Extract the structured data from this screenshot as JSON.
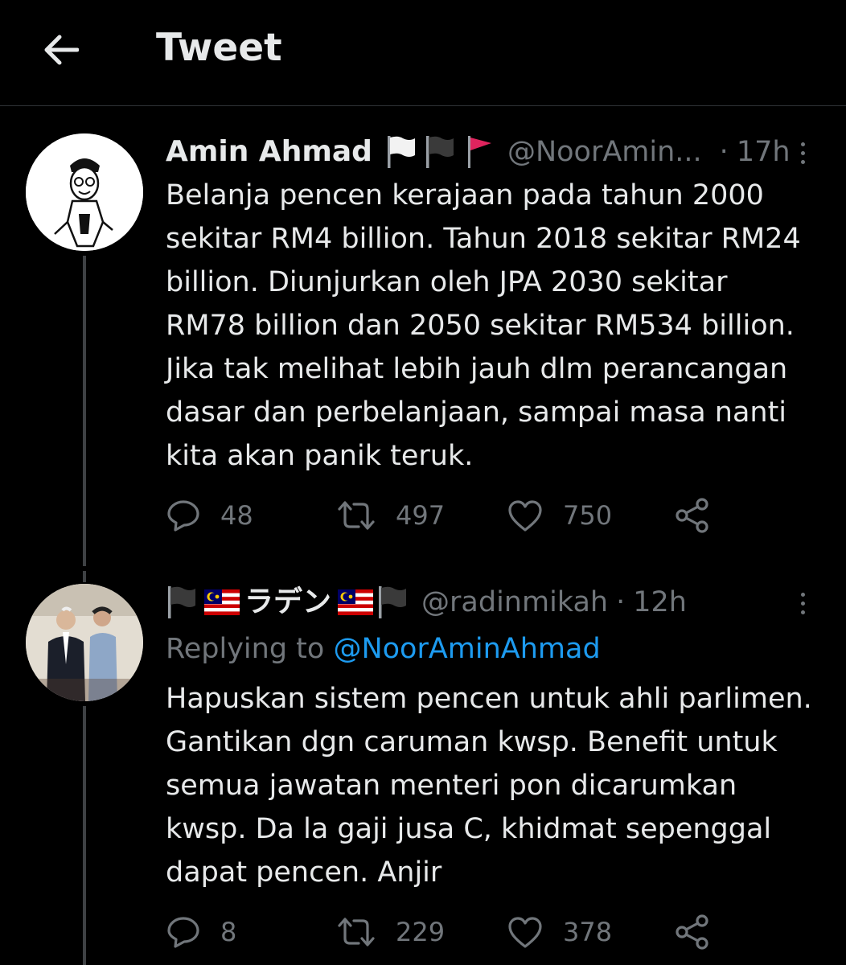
{
  "header": {
    "title": "Tweet",
    "back_icon": "arrow-left-icon"
  },
  "tweets": [
    {
      "author_name": "Amin Ahmad",
      "flags": [
        "white-flag-icon",
        "black-flag-icon",
        "red-flag-icon"
      ],
      "handle": "@NoorAmin...",
      "separator": "·",
      "time": "17h",
      "text": "Belanja pencen kerajaan pada tahun 2000\nsekitar RM4 billion. Tahun 2018 sekitar RM24\nbillion. Diunjurkan oleh JPA 2030 sekitar\nRM78 billion dan 2050 sekitar RM534 billion.\nJika tak melihat lebih jauh dlm perancangan\ndasar dan perbelanjaan, sampai masa nanti\nkita akan panik teruk.",
      "replies": "48",
      "retweets": "497",
      "likes": "750"
    },
    {
      "author_name": "ラデン",
      "handle": "@radinmikah",
      "separator": "·",
      "time": "12h",
      "replying_prefix": "Replying to ",
      "replying_to": "@NoorAminAhmad",
      "text": "Hapuskan sistem pencen untuk ahli parlimen.\nGantikan dgn caruman kwsp. Benefit untuk\nsemua jawatan menteri pon dicarumkan\nkwsp. Da la gaji jusa C, khidmat sepenggal\ndapat pencen. Anjir",
      "replies": "8",
      "retweets": "229",
      "likes": "378"
    }
  ],
  "colors": {
    "background": "#000000",
    "text": "#e7e9ea",
    "muted": "#71767b",
    "link": "#1d9bf0",
    "divider": "#2f3336"
  }
}
